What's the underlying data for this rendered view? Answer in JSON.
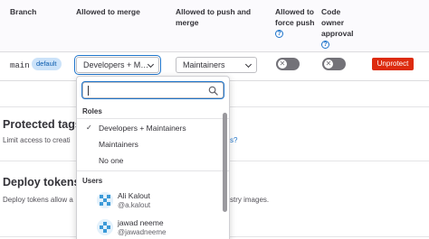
{
  "table": {
    "headers": {
      "branch": "Branch",
      "allowed_to_merge": "Allowed to merge",
      "allowed_to_push_merge": "Allowed to push and merge",
      "allowed_force_push": "Allowed to force push",
      "code_owner_approval": "Code owner approval"
    },
    "row": {
      "branch": "main",
      "badge": "default",
      "merge_value": "Developers + M…",
      "push_value": "Maintainers",
      "force_push_enabled": false,
      "code_owner_enabled": false,
      "unprotect_label": "Unprotect"
    }
  },
  "sections": {
    "protected_tags": {
      "title": "Protected tags",
      "desc": "Limit access to creati",
      "desc_link": "s?"
    },
    "deploy_tokens": {
      "title": "Deploy tokens",
      "desc": "Deploy tokens allow a",
      "desc_tail": "stry images."
    }
  },
  "dropdown": {
    "search_placeholder": "",
    "roles_label": "Roles",
    "roles": [
      {
        "label": "Developers + Maintainers",
        "checked": true
      },
      {
        "label": "Maintainers",
        "checked": false
      },
      {
        "label": "No one",
        "checked": false
      }
    ],
    "users_label": "Users",
    "users": [
      {
        "name": "Ali Kalout",
        "handle": "@a.kalout"
      },
      {
        "name": "jawad neeme",
        "handle": "@jawadneeme"
      }
    ]
  },
  "colors": {
    "accent": "#1f75cb",
    "danger": "#dd2b0e",
    "toggle_off": "#737278"
  },
  "icons": {
    "search": "search-icon",
    "check": "check-icon",
    "help": "question-circle-icon",
    "chevron": "chevron-down-icon"
  }
}
